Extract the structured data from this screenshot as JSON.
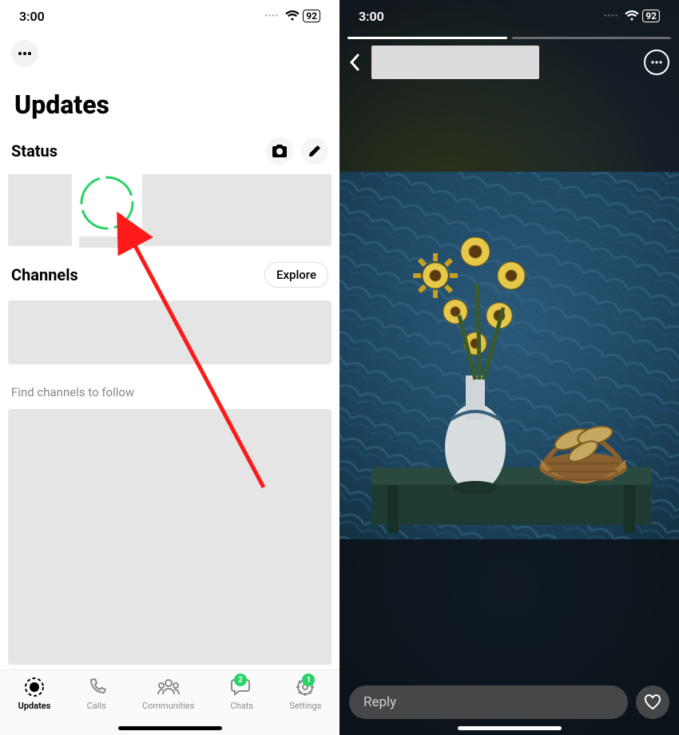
{
  "statusbar": {
    "time": "3:00",
    "battery": "92"
  },
  "left": {
    "title": "Updates",
    "status_section": "Status",
    "channels_section": "Channels",
    "explore_btn": "Explore",
    "find_channels": "Find channels to follow",
    "tabs": {
      "updates": "Updates",
      "calls": "Calls",
      "communities": "Communities",
      "chats": "Chats",
      "settings": "Settings",
      "chats_badge": "2",
      "settings_badge": "1"
    }
  },
  "right": {
    "reply_placeholder": "Reply"
  },
  "colors": {
    "accent_green": "#25d366",
    "arrow_red": "#ff1a1a"
  }
}
